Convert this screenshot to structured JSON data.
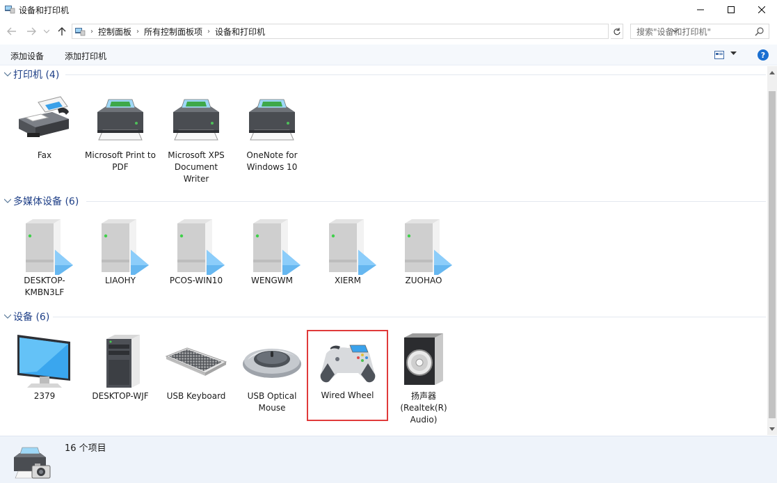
{
  "window": {
    "title": "设备和打印机",
    "controls": {
      "minimize": "—",
      "maximize": "☐",
      "close": "✕"
    }
  },
  "address": {
    "back_icon": "back-arrow-icon",
    "forward_icon": "forward-arrow-icon",
    "breadcrumbs": [
      "控制面板",
      "所有控制面板项",
      "设备和打印机"
    ],
    "search_placeholder": "搜索\"设备和打印机\""
  },
  "commandbar": {
    "add_device": "添加设备",
    "add_printer": "添加打印机"
  },
  "groups": [
    {
      "title": "打印机 (4)",
      "items": [
        {
          "label": "Fax",
          "icon": "fax-icon"
        },
        {
          "label": "Microsoft Print to PDF",
          "icon": "printer-icon"
        },
        {
          "label": "Microsoft XPS Document Writer",
          "icon": "printer-icon"
        },
        {
          "label": "OneNote for Windows 10",
          "icon": "printer-icon"
        }
      ]
    },
    {
      "title": "多媒体设备 (6)",
      "items": [
        {
          "label": "DESKTOP-KMBN3LF",
          "icon": "media-server-icon"
        },
        {
          "label": "LIAOHY",
          "icon": "media-server-icon"
        },
        {
          "label": "PCOS-WIN10",
          "icon": "media-server-icon"
        },
        {
          "label": "WENGWM",
          "icon": "media-server-icon"
        },
        {
          "label": "XIERM",
          "icon": "media-server-icon"
        },
        {
          "label": "ZUOHAO",
          "icon": "media-server-icon"
        }
      ]
    },
    {
      "title": "设备 (6)",
      "items": [
        {
          "label": "2379",
          "icon": "monitor-icon"
        },
        {
          "label": "DESKTOP-WJF",
          "icon": "tower-pc-icon"
        },
        {
          "label": "USB Keyboard",
          "icon": "keyboard-icon"
        },
        {
          "label": "USB Optical Mouse",
          "icon": "mouse-icon"
        },
        {
          "label": "Wired Wheel",
          "icon": "gamepad-icon",
          "selected": true
        },
        {
          "label": "扬声器 (Realtek(R) Audio)",
          "icon": "speaker-icon"
        }
      ]
    }
  ],
  "status": {
    "count_text": "16 个项目"
  },
  "colors": {
    "group_title": "#1e3f87",
    "selection_border": "#e03a3a",
    "details_bg": "#eef3fa"
  }
}
